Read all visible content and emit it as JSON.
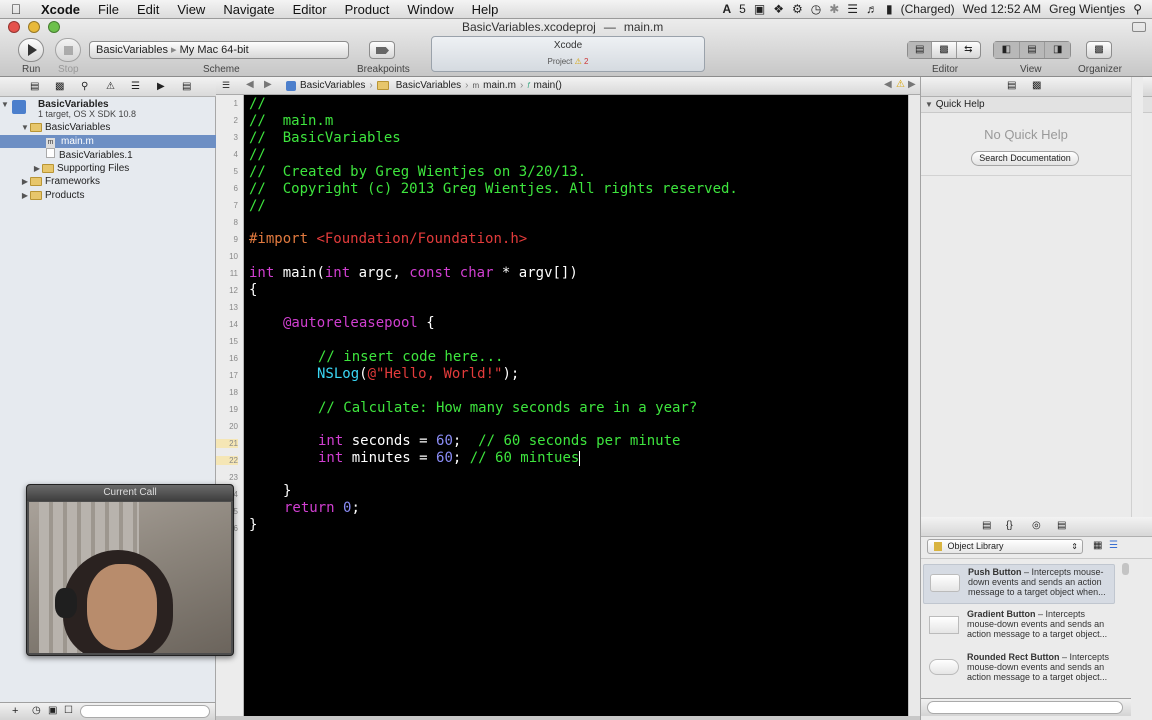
{
  "menubar": {
    "app": "Xcode",
    "items": [
      "File",
      "Edit",
      "View",
      "Navigate",
      "Editor",
      "Product",
      "Window",
      "Help"
    ],
    "status": {
      "adobe_count": "5",
      "battery": "(Charged)",
      "clock": "Wed 12:52 AM",
      "user": "Greg Wientjes"
    }
  },
  "window": {
    "project_file": "BasicVariables.xcodeproj",
    "current_file": "main.m"
  },
  "toolbar": {
    "run_label": "Run",
    "stop_label": "Stop",
    "scheme_target": "BasicVariables",
    "scheme_device": "My Mac 64-bit",
    "scheme_label": "Scheme",
    "breakpoints_label": "Breakpoints",
    "activity_title": "Xcode",
    "activity_project": "Project",
    "activity_warnings": "2",
    "editor_label": "Editor",
    "view_label": "View",
    "organizer_label": "Organizer"
  },
  "navigator": {
    "project_name": "BasicVariables",
    "project_sub": "1 target, OS X SDK 10.8",
    "items": [
      {
        "label": "BasicVariables",
        "type": "group"
      },
      {
        "label": "main.m",
        "type": "file"
      },
      {
        "label": "BasicVariables.1",
        "type": "file"
      },
      {
        "label": "Supporting Files",
        "type": "group"
      },
      {
        "label": "Frameworks",
        "type": "group"
      },
      {
        "label": "Products",
        "type": "group"
      }
    ]
  },
  "jumpbar": {
    "crumbs": [
      "BasicVariables",
      "BasicVariables",
      "main.m",
      "main()"
    ]
  },
  "code": {
    "line_numbers": [
      "1",
      "2",
      "3",
      "4",
      "5",
      "6",
      "7",
      "8",
      "9",
      "10",
      "11",
      "12",
      "13",
      "14",
      "15",
      "16",
      "17",
      "18",
      "19",
      "20",
      "21",
      "22",
      "23",
      "24",
      "25",
      "26"
    ],
    "l1": "//",
    "l2": "//  main.m",
    "l3": "//  BasicVariables",
    "l4": "//",
    "l5": "//  Created by Greg Wientjes on 3/20/13.",
    "l6": "//  Copyright (c) 2013 Greg Wientjes. All rights reserved.",
    "l7": "//",
    "l9_kw": "#import",
    "l9_path": "<Foundation/Foundation.h>",
    "l11_int": "int",
    "l11_main": " main(",
    "l11_int2": "int",
    "l11_argc": " argc, ",
    "l11_const": "const",
    "l11_sp": " ",
    "l11_char": "char",
    "l11_rest": " * argv[])",
    "l12": "{",
    "l14_kw": "@autoreleasepool",
    "l14_rest": " {",
    "l16": "// insert code here...",
    "l17_fn": "NSLog",
    "l17_p": "(",
    "l17_str": "@\"Hello, World!\"",
    "l17_end": ");",
    "l19": "// Calculate: How many seconds are in a year?",
    "l21_int": "int",
    "l21_var": " seconds = ",
    "l21_num": "60",
    "l21_semi": ";  ",
    "l21_cm": "// 60 seconds per minute",
    "l22_int": "int",
    "l22_var": " minutes = ",
    "l22_num": "60",
    "l22_semi": "; ",
    "l22_cm": "// 60 mintues",
    "l24": "}",
    "l25_kw": "return",
    "l25_sp": " ",
    "l25_num": "0",
    "l25_semi": ";",
    "l26": "}"
  },
  "quick_help": {
    "title": "Quick Help",
    "empty": "No Quick Help",
    "search_button": "Search Documentation"
  },
  "library": {
    "selector": "Object Library",
    "items": [
      {
        "name": "Push Button",
        "desc": " – Intercepts mouse-down events and sends an action message to a target object when..."
      },
      {
        "name": "Gradient Button",
        "desc": " – Intercepts mouse-down events and sends an action message to a target object..."
      },
      {
        "name": "Rounded Rect Button",
        "desc": " – Intercepts mouse-down events and sends an action message to a target object..."
      }
    ]
  },
  "call": {
    "title": "Current Call"
  }
}
